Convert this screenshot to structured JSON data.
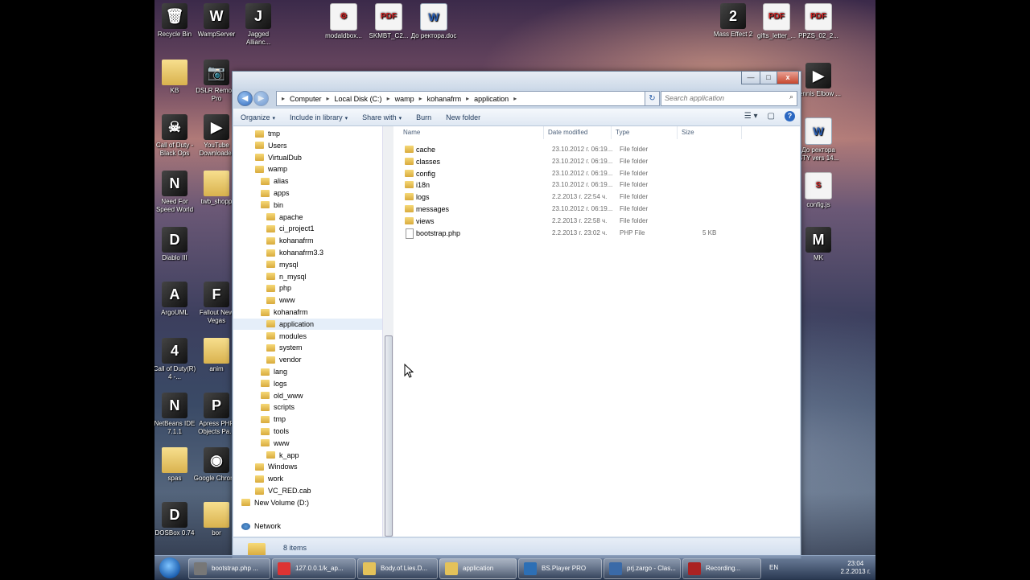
{
  "desktop": {
    "icons_left": [
      {
        "label": "Recycle Bin",
        "glyph": "🗑",
        "kind": "game"
      },
      {
        "label": "WampServer",
        "glyph": "W",
        "kind": "game"
      },
      {
        "label": "Jagged Allianc...",
        "glyph": "J",
        "kind": "game"
      },
      {
        "label": "KB",
        "glyph": "",
        "kind": "folder"
      },
      {
        "label": "DSLR Remote Pro",
        "glyph": "📷",
        "kind": "game"
      },
      {
        "label": "Call of Duty - Black Ops",
        "glyph": "☠",
        "kind": "game"
      },
      {
        "label": "YouTube Downloader",
        "glyph": "▶",
        "kind": "game"
      },
      {
        "label": "Need For Speed World",
        "glyph": "N",
        "kind": "game"
      },
      {
        "label": "twb_shopp",
        "glyph": "",
        "kind": "folder"
      },
      {
        "label": "Diablo III",
        "glyph": "D",
        "kind": "game"
      },
      {
        "label": "ArgoUML",
        "glyph": "A",
        "kind": "game"
      },
      {
        "label": "Fallout New Vegas",
        "glyph": "F",
        "kind": "game"
      },
      {
        "label": "Call of Duty(R) 4 -...",
        "glyph": "4",
        "kind": "game"
      },
      {
        "label": "anim",
        "glyph": "",
        "kind": "folder"
      },
      {
        "label": "NetBeans IDE 7.1.1",
        "glyph": "N",
        "kind": "game"
      },
      {
        "label": "Apress PHP Objects Pa...",
        "glyph": "P",
        "kind": "game"
      },
      {
        "label": "spas",
        "glyph": "",
        "kind": "folder"
      },
      {
        "label": "Google Chrome",
        "glyph": "◉",
        "kind": "game"
      },
      {
        "label": "DOSBox 0.74",
        "glyph": "D",
        "kind": "game"
      },
      {
        "label": "bor",
        "glyph": "",
        "kind": "folder"
      }
    ],
    "icons_top": [
      {
        "label": "modaldbox...",
        "glyph": "⚙",
        "kind": "doc"
      },
      {
        "label": "SKMBT_C2...",
        "glyph": "PDF",
        "kind": "doc"
      },
      {
        "label": "До ректора.doc",
        "glyph": "W",
        "kind": "word"
      }
    ],
    "icons_right": [
      {
        "label": "Mass Effect 2",
        "glyph": "2",
        "kind": "game"
      },
      {
        "label": "gifts_letter_...",
        "glyph": "PDF",
        "kind": "doc"
      },
      {
        "label": "PPZS_02_2...",
        "glyph": "PDF",
        "kind": "doc"
      },
      {
        "label": "Tennis Elbow ...",
        "glyph": "▶",
        "kind": "game"
      },
      {
        "label": "До ректора STY vers 14...",
        "glyph": "W",
        "kind": "word"
      },
      {
        "label": "config.js",
        "glyph": "S",
        "kind": "doc"
      },
      {
        "label": "MK",
        "glyph": "M",
        "kind": "game"
      }
    ]
  },
  "window": {
    "title_buttons": {
      "minimize": "—",
      "maximize": "□",
      "close": "x"
    },
    "nav": {
      "back": "◀",
      "forward": "▶"
    },
    "breadcrumb": [
      "Computer",
      "Local Disk (C:)",
      "wamp",
      "kohanafrm",
      "application"
    ],
    "search_placeholder": "Search application",
    "toolbar": {
      "organize": "Organize",
      "include": "Include in library",
      "share": "Share with",
      "burn": "Burn",
      "new_folder": "New folder",
      "caret": "▾"
    },
    "tree": [
      {
        "label": "tmp",
        "depth": 1
      },
      {
        "label": "Users",
        "depth": 1
      },
      {
        "label": "VirtualDub",
        "depth": 1
      },
      {
        "label": "wamp",
        "depth": 1
      },
      {
        "label": "alias",
        "depth": 2
      },
      {
        "label": "apps",
        "depth": 2
      },
      {
        "label": "bin",
        "depth": 2
      },
      {
        "label": "apache",
        "depth": 3
      },
      {
        "label": "ci_project1",
        "depth": 3
      },
      {
        "label": "kohanafrm",
        "depth": 3
      },
      {
        "label": "kohanafrm3.3",
        "depth": 3
      },
      {
        "label": "mysql",
        "depth": 3
      },
      {
        "label": "n_mysql",
        "depth": 3
      },
      {
        "label": "php",
        "depth": 3
      },
      {
        "label": "www",
        "depth": 3
      },
      {
        "label": "kohanafrm",
        "depth": 2
      },
      {
        "label": "application",
        "depth": 3,
        "selected": true
      },
      {
        "label": "modules",
        "depth": 3
      },
      {
        "label": "system",
        "depth": 3
      },
      {
        "label": "vendor",
        "depth": 3
      },
      {
        "label": "lang",
        "depth": 2
      },
      {
        "label": "logs",
        "depth": 2
      },
      {
        "label": "old_www",
        "depth": 2
      },
      {
        "label": "scripts",
        "depth": 2
      },
      {
        "label": "tmp",
        "depth": 2
      },
      {
        "label": "tools",
        "depth": 2
      },
      {
        "label": "www",
        "depth": 2
      },
      {
        "label": "k_app",
        "depth": 3
      },
      {
        "label": "Windows",
        "depth": 1
      },
      {
        "label": "work",
        "depth": 1
      },
      {
        "label": "VC_RED.cab",
        "depth": 1
      },
      {
        "label": "New Volume (D:)",
        "depth": 0
      },
      {
        "label": "",
        "depth": 0
      },
      {
        "label": "Network",
        "depth": 0
      }
    ],
    "columns": [
      "Name",
      "Date modified",
      "Type",
      "Size"
    ],
    "files": [
      {
        "name": "cache",
        "date": "23.10.2012 г. 06:19...",
        "type": "File folder",
        "size": "",
        "folder": true
      },
      {
        "name": "classes",
        "date": "23.10.2012 г. 06:19...",
        "type": "File folder",
        "size": "",
        "folder": true
      },
      {
        "name": "config",
        "date": "23.10.2012 г. 06:19...",
        "type": "File folder",
        "size": "",
        "folder": true
      },
      {
        "name": "i18n",
        "date": "23.10.2012 г. 06:19...",
        "type": "File folder",
        "size": "",
        "folder": true
      },
      {
        "name": "logs",
        "date": "2.2.2013 г. 22:54 ч.",
        "type": "File folder",
        "size": "",
        "folder": true
      },
      {
        "name": "messages",
        "date": "23.10.2012 г. 06:19...",
        "type": "File folder",
        "size": "",
        "folder": true
      },
      {
        "name": "views",
        "date": "2.2.2013 г. 22:58 ч.",
        "type": "File folder",
        "size": "",
        "folder": true
      },
      {
        "name": "bootstrap.php",
        "date": "2.2.2013 г. 23:02 ч.",
        "type": "PHP File",
        "size": "5 KB",
        "folder": false
      }
    ],
    "status": "8 items"
  },
  "taskbar": {
    "tasks": [
      {
        "label": "bootstrap.php ...",
        "color": "#777"
      },
      {
        "label": "127.0.0.1/k_ap...",
        "color": "#d33"
      },
      {
        "label": "Body.of.Lies.D...",
        "color": "#e4c25a"
      },
      {
        "label": "application",
        "color": "#e4c25a",
        "active": true
      },
      {
        "label": "BS.Player PRO",
        "color": "#2d6fb5"
      },
      {
        "label": "prj.zargo - Clas...",
        "color": "#3a6aa8"
      },
      {
        "label": "Recording...",
        "color": "#a22"
      }
    ],
    "lang": "EN",
    "time": "23:04",
    "date": "2.2.2013 г."
  }
}
